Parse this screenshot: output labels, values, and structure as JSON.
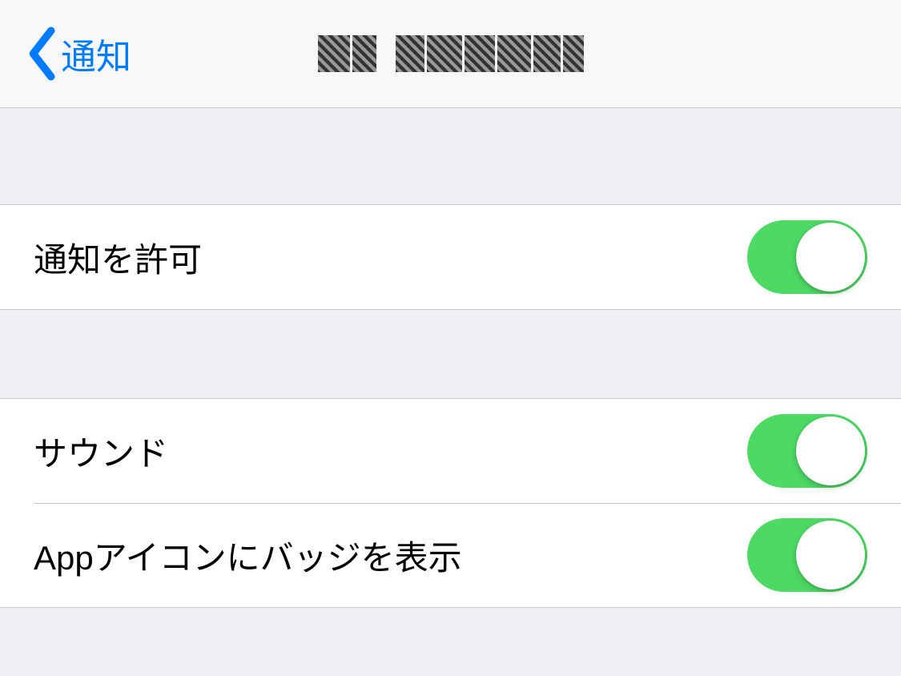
{
  "navbar": {
    "back_label": "通知",
    "title_obscured": true
  },
  "sections": {
    "allow": {
      "label": "通知を許可",
      "on": true
    },
    "sounds": {
      "label": "サウンド",
      "on": true
    },
    "badge": {
      "label": "Appアイコンにバッジを表示",
      "on": true
    }
  },
  "colors": {
    "accent": "#007aff",
    "toggle_on": "#4cd964",
    "background": "#efeff4",
    "row_background": "#ffffff",
    "separator": "#c8c7cc"
  }
}
